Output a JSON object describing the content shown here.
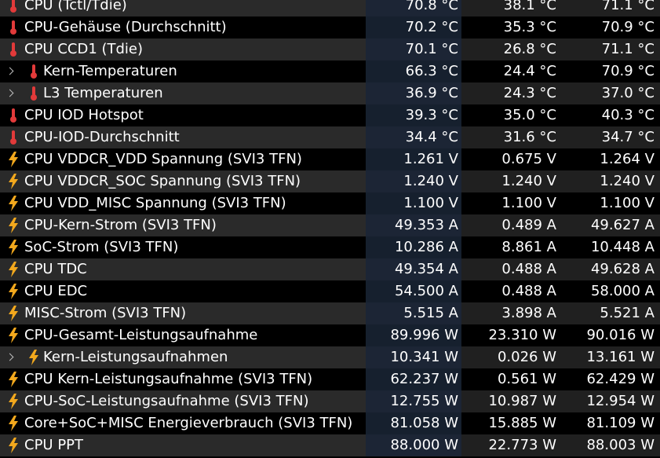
{
  "colors": {
    "background": "#000000",
    "row_alt": "#202020",
    "current_column_tint": "#16202e",
    "thermometer_icon": "#e23a3a",
    "bolt_icon": "#f2a81d",
    "text": "#ffffff"
  },
  "rows": [
    {
      "label": "CPU (Tctl/Tdie)",
      "icon": "thermometer-icon",
      "indent": false,
      "expandable": false,
      "current": "70.8 °C",
      "min": "38.1 °C",
      "max": "71.1 °C"
    },
    {
      "label": "CPU-Gehäuse (Durchschnitt)",
      "icon": "thermometer-icon",
      "indent": false,
      "expandable": false,
      "current": "70.2 °C",
      "min": "35.3 °C",
      "max": "70.9 °C"
    },
    {
      "label": "CPU CCD1 (Tdie)",
      "icon": "thermometer-icon",
      "indent": false,
      "expandable": false,
      "current": "70.1 °C",
      "min": "26.8 °C",
      "max": "71.1 °C"
    },
    {
      "label": "Kern-Temperaturen",
      "icon": "thermometer-icon",
      "indent": true,
      "expandable": true,
      "current": "66.3 °C",
      "min": "24.4 °C",
      "max": "70.9 °C"
    },
    {
      "label": "L3 Temperaturen",
      "icon": "thermometer-icon",
      "indent": true,
      "expandable": true,
      "current": "36.9 °C",
      "min": "24.3 °C",
      "max": "37.0 °C"
    },
    {
      "label": "CPU IOD Hotspot",
      "icon": "thermometer-icon",
      "indent": false,
      "expandable": false,
      "current": "39.3 °C",
      "min": "35.0 °C",
      "max": "40.3 °C"
    },
    {
      "label": "CPU-IOD-Durchschnitt",
      "icon": "thermometer-icon",
      "indent": false,
      "expandable": false,
      "current": "34.4 °C",
      "min": "31.6 °C",
      "max": "34.7 °C"
    },
    {
      "label": "CPU VDDCR_VDD Spannung (SVI3 TFN)",
      "icon": "bolt-icon",
      "indent": false,
      "expandable": false,
      "current": "1.261 V",
      "min": "0.675 V",
      "max": "1.264 V"
    },
    {
      "label": "CPU VDDCR_SOC Spannung (SVI3 TFN)",
      "icon": "bolt-icon",
      "indent": false,
      "expandable": false,
      "current": "1.240 V",
      "min": "1.240 V",
      "max": "1.240 V"
    },
    {
      "label": "CPU VDD_MISC Spannung (SVI3 TFN)",
      "icon": "bolt-icon",
      "indent": false,
      "expandable": false,
      "current": "1.100 V",
      "min": "1.100 V",
      "max": "1.100 V"
    },
    {
      "label": "CPU-Kern-Strom (SVI3 TFN)",
      "icon": "bolt-icon",
      "indent": false,
      "expandable": false,
      "current": "49.353 A",
      "min": "0.489 A",
      "max": "49.627 A"
    },
    {
      "label": "SoC-Strom (SVI3 TFN)",
      "icon": "bolt-icon",
      "indent": false,
      "expandable": false,
      "current": "10.286 A",
      "min": "8.861 A",
      "max": "10.448 A"
    },
    {
      "label": "CPU TDC",
      "icon": "bolt-icon",
      "indent": false,
      "expandable": false,
      "current": "49.354 A",
      "min": "0.488 A",
      "max": "49.628 A"
    },
    {
      "label": "CPU EDC",
      "icon": "bolt-icon",
      "indent": false,
      "expandable": false,
      "current": "54.500 A",
      "min": "0.488 A",
      "max": "58.000 A"
    },
    {
      "label": "MISC-Strom (SVI3 TFN)",
      "icon": "bolt-icon",
      "indent": false,
      "expandable": false,
      "current": "5.515 A",
      "min": "3.898 A",
      "max": "5.521 A"
    },
    {
      "label": "CPU-Gesamt-Leistungsaufnahme",
      "icon": "bolt-icon",
      "indent": false,
      "expandable": false,
      "current": "89.996 W",
      "min": "23.310 W",
      "max": "90.016 W"
    },
    {
      "label": "Kern-Leistungsaufnahmen",
      "icon": "bolt-icon",
      "indent": true,
      "expandable": true,
      "current": "10.341 W",
      "min": "0.026 W",
      "max": "13.161 W"
    },
    {
      "label": "CPU Kern-Leistungsaufnahme (SVI3 TFN)",
      "icon": "bolt-icon",
      "indent": false,
      "expandable": false,
      "current": "62.237 W",
      "min": "0.561 W",
      "max": "62.429 W"
    },
    {
      "label": "CPU-SoC-Leistungsaufnahme (SVI3 TFN)",
      "icon": "bolt-icon",
      "indent": false,
      "expandable": false,
      "current": "12.755 W",
      "min": "10.987 W",
      "max": "12.954 W"
    },
    {
      "label": "Core+SoC+MISC Energieverbrauch (SVI3 TFN)",
      "icon": "bolt-icon",
      "indent": false,
      "expandable": false,
      "current": "81.058 W",
      "min": "15.885 W",
      "max": "81.109 W"
    },
    {
      "label": "CPU PPT",
      "icon": "bolt-icon",
      "indent": false,
      "expandable": false,
      "current": "88.000 W",
      "min": "22.773 W",
      "max": "88.003 W"
    }
  ]
}
